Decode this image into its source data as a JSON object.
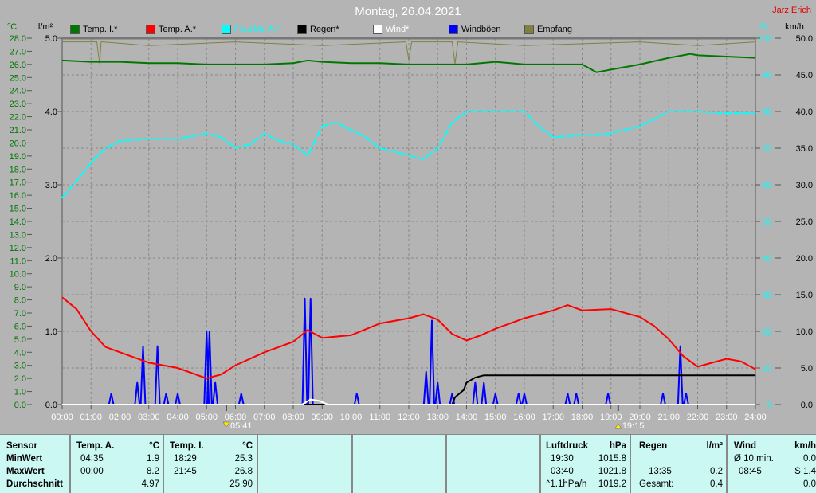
{
  "header": {
    "title": "Montag, 26.04.2021",
    "author": "Jarz Erich"
  },
  "legend": [
    {
      "label": "Temp. I.*",
      "color": "#007800"
    },
    {
      "label": "Temp. A.*",
      "color": "#ff0000"
    },
    {
      "label": "Feuchte A.*",
      "color": "#00ffff"
    },
    {
      "label": "Regen*",
      "color": "#000000"
    },
    {
      "label": "Wind*",
      "color": "#ffffff"
    },
    {
      "label": "Windböen",
      "color": "#0000ff"
    },
    {
      "label": "Empfang",
      "color": "#808040"
    }
  ],
  "sun": {
    "rise": "05:41",
    "set": "19:15",
    "rise_h": 5.683,
    "set_h": 19.25
  },
  "chart_data": {
    "type": "line",
    "title": "Montag, 26.04.2021",
    "axes": {
      "temp": {
        "label": "°C",
        "min": 0,
        "max": 28,
        "step": 1,
        "ticks": [
          "0.0",
          "1.0",
          "2.0",
          "3.0",
          "4.0",
          "5.0",
          "6.0",
          "7.0",
          "8.0",
          "9.0",
          "10.0",
          "11.0",
          "12.0",
          "13.0",
          "14.0",
          "15.0",
          "16.0",
          "17.0",
          "18.0",
          "19.0",
          "20.0",
          "21.0",
          "22.0",
          "23.0",
          "24.0",
          "25.0",
          "26.0",
          "27.0",
          "28.0"
        ]
      },
      "rain": {
        "label": "l/m²",
        "min": 0,
        "max": 5,
        "ticks": [
          "0.0",
          "1.0",
          "2.0",
          "3.0",
          "4.0",
          "5.0"
        ]
      },
      "hum": {
        "label": "%",
        "min": 0,
        "max": 100,
        "ticks": [
          "0",
          "10",
          "20",
          "30",
          "40",
          "50",
          "60",
          "70",
          "80",
          "90",
          "100"
        ]
      },
      "wind": {
        "label": "km/h",
        "min": 0,
        "max": 50,
        "ticks": [
          "0.0",
          "5.0",
          "10.0",
          "15.0",
          "20.0",
          "25.0",
          "30.0",
          "35.0",
          "40.0",
          "45.0",
          "50.0"
        ]
      },
      "x": {
        "min": 0,
        "max": 24,
        "ticks": [
          "00:00",
          "01:00",
          "02:00",
          "03:00",
          "04:00",
          "05:00",
          "06:00",
          "07:00",
          "08:00",
          "09:00",
          "10:00",
          "11:00",
          "12:00",
          "13:00",
          "14:00",
          "15:00",
          "16:00",
          "17:00",
          "18:00",
          "19:00",
          "20:00",
          "21:00",
          "22:00",
          "23:00",
          "24:00"
        ]
      }
    },
    "series": [
      {
        "name": "Empfang",
        "axis": "hum",
        "color": "#808040",
        "x": [
          0,
          1.2,
          1.3,
          1.35,
          1.4,
          3,
          6,
          9,
          11.9,
          12,
          12.1,
          13.5,
          13.6,
          13.7,
          16,
          20,
          22,
          24
        ],
        "y": [
          99,
          99,
          93,
          99,
          99,
          98,
          99,
          98,
          99,
          94,
          99,
          99,
          93,
          99,
          98,
          99,
          98,
          99
        ]
      },
      {
        "name": "Temp. I.*",
        "axis": "temp",
        "color": "#007800",
        "x": [
          0,
          1,
          2,
          3,
          4,
          5,
          6,
          7,
          8,
          8.5,
          9,
          10,
          11,
          12,
          13,
          14,
          15,
          16,
          17,
          18,
          18.5,
          19,
          20,
          21,
          21.75,
          22,
          23,
          24
        ],
        "y": [
          26.3,
          26.2,
          26.2,
          26.1,
          26.1,
          26.0,
          26.0,
          26.0,
          26.1,
          26.3,
          26.2,
          26.1,
          26.1,
          26.0,
          26.0,
          26.0,
          26.2,
          26.0,
          26.0,
          26.0,
          25.4,
          25.6,
          26.0,
          26.5,
          26.8,
          26.7,
          26.6,
          26.5
        ]
      },
      {
        "name": "Feuchte A.*",
        "axis": "hum",
        "color": "#00ffff",
        "x": [
          0,
          0.5,
          1,
          1.5,
          2,
          3,
          4,
          5,
          5.5,
          6,
          6.5,
          7,
          7.5,
          8,
          8.5,
          9,
          9.5,
          10,
          10.5,
          11,
          12,
          12.5,
          13,
          13.5,
          14,
          15,
          16,
          16.5,
          17,
          18,
          19,
          20,
          21,
          22,
          23,
          24
        ],
        "y": [
          56.5,
          61,
          66,
          70,
          72,
          72.5,
          72.5,
          74,
          73,
          70,
          71,
          74,
          72,
          71,
          68,
          76,
          77,
          75,
          73,
          70,
          68,
          67,
          70,
          77,
          80,
          80,
          80,
          76,
          73,
          73.5,
          74,
          76,
          80,
          80,
          79.5,
          79.5
        ]
      },
      {
        "name": "Regen*",
        "axis": "rain",
        "color": "#000000",
        "x": [
          0,
          13.5,
          13.55,
          13.6,
          13.9,
          14,
          14.3,
          14.6,
          15,
          24
        ],
        "y": [
          0,
          0,
          0.05,
          0.1,
          0.2,
          0.3,
          0.37,
          0.4,
          0.4,
          0.4
        ]
      },
      {
        "name": "Wind*",
        "axis": "wind",
        "color": "#ffffff",
        "x": [
          0,
          8.3,
          8.6,
          8.9,
          9.2,
          24
        ],
        "y": [
          0,
          0,
          0.7,
          0.5,
          0,
          0
        ]
      },
      {
        "name": "Temp. A.*",
        "axis": "temp",
        "color": "#ff0000",
        "x": [
          0,
          0.5,
          1,
          1.5,
          2,
          3,
          4,
          5,
          5.5,
          6,
          7,
          8,
          8.5,
          9,
          10,
          11,
          12,
          12.5,
          13,
          13.5,
          14,
          14.5,
          15,
          16,
          17,
          17.5,
          18,
          19,
          20,
          20.5,
          21,
          21.5,
          22,
          23,
          23.5,
          24
        ],
        "y": [
          8.2,
          7.3,
          5.6,
          4.4,
          4.0,
          3.2,
          2.8,
          2.0,
          2.3,
          3.0,
          4.0,
          4.8,
          5.7,
          5.1,
          5.3,
          6.2,
          6.6,
          6.9,
          6.5,
          5.4,
          4.9,
          5.3,
          5.8,
          6.6,
          7.2,
          7.6,
          7.2,
          7.3,
          6.7,
          6.0,
          5.0,
          3.7,
          2.9,
          3.5,
          3.3,
          2.7
        ]
      }
    ],
    "gusts": {
      "name": "Windböen",
      "axis": "wind",
      "color": "#0000ff",
      "x": [
        1.7,
        2.6,
        2.8,
        3.3,
        3.6,
        4.0,
        5.0,
        5.1,
        5.3,
        6.2,
        8.4,
        8.6,
        10.2,
        12.6,
        12.8,
        13.0,
        13.5,
        14.3,
        14.6,
        15.0,
        15.8,
        16.0,
        17.5,
        17.8,
        18.9,
        20.8,
        21.4,
        21.6
      ],
      "y": [
        1.5,
        3,
        8,
        8,
        1.5,
        1.5,
        10,
        10,
        3,
        1.5,
        14.5,
        14.5,
        1.5,
        4.5,
        11.5,
        3,
        1.5,
        3,
        3,
        1.5,
        1.5,
        1.5,
        1.5,
        1.5,
        1.5,
        1.5,
        8,
        1.5
      ]
    }
  },
  "table": {
    "labels": [
      "Sensor",
      "MinWert",
      "MaxWert",
      "Durchschnitt"
    ],
    "temp_a": {
      "title": "Temp. A.",
      "unit": "°C",
      "min_time": "04:35",
      "min": "1.9",
      "max_time": "00:00",
      "max": "8.2",
      "avg": "4.97"
    },
    "temp_i": {
      "title": "Temp. I.",
      "unit": "°C",
      "min_time": "18:29",
      "min": "25.3",
      "max_time": "21:45",
      "max": "26.8",
      "avg": "25.90"
    },
    "pressure": {
      "title": "Luftdruck",
      "unit": "hPa",
      "min_time": "19:30",
      "min": "1015.8",
      "max_time": "03:40",
      "max": "1021.8",
      "trend": "^1.1hPa/h",
      "current": "1019.2"
    },
    "rain": {
      "title": "Regen",
      "unit": "l/m²",
      "max_time": "13:35",
      "max": "0.2",
      "total_label": "Gesamt:",
      "total": "0.4"
    },
    "wind": {
      "title": "Wind",
      "unit": "km/h",
      "avg_label": "Ø 10 min.",
      "avg": "0.0",
      "max_time": "08:45",
      "max": "S 1.4",
      "current": "0.0"
    }
  }
}
